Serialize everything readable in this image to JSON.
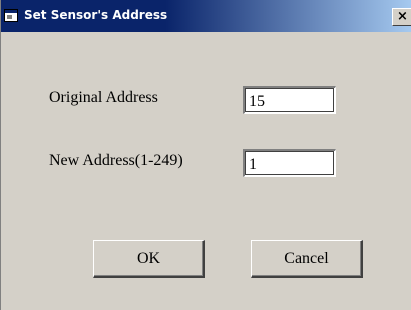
{
  "window": {
    "title": "Set Sensor's Address",
    "close_glyph": "×",
    "titlebar_color": "#0a246a",
    "face_color": "#d4d0c8"
  },
  "form": {
    "original_label": "Original Address",
    "original_value": "15",
    "new_label": "New Address(1-249)",
    "new_value": "1"
  },
  "buttons": {
    "ok": "OK",
    "cancel": "Cancel"
  },
  "icons": {
    "app": "app-window-icon",
    "close": "close-icon"
  }
}
